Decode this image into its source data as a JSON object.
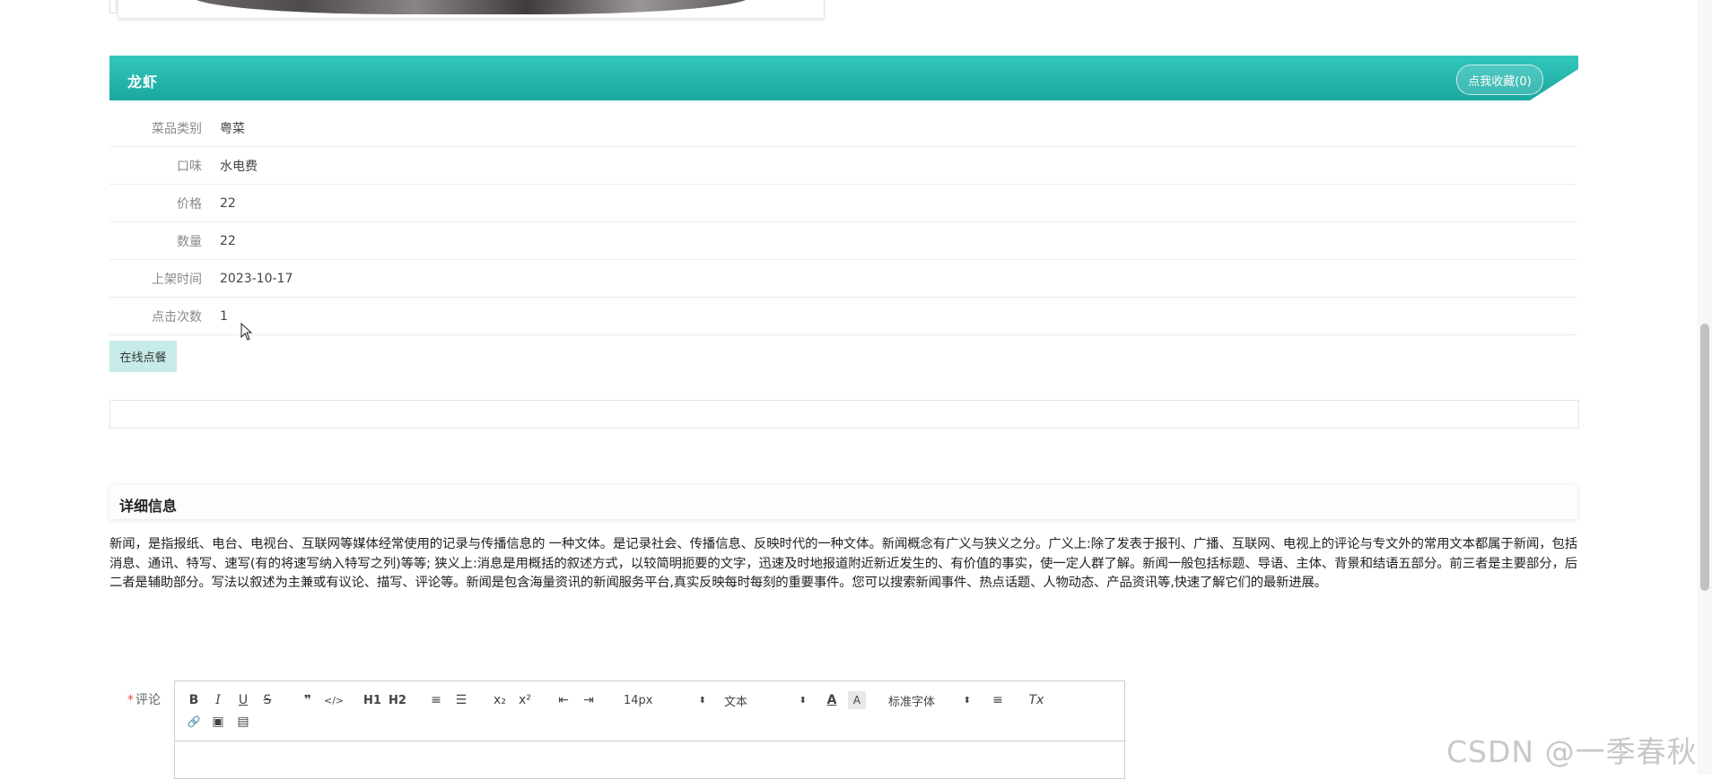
{
  "dish": {
    "title": "龙虾",
    "collect_button": "点我收藏(0)"
  },
  "info_rows": [
    {
      "label": "菜品类别",
      "value": "粤菜"
    },
    {
      "label": "口味",
      "value": "水电费"
    },
    {
      "label": "价格",
      "value": "22"
    },
    {
      "label": "数量",
      "value": "22"
    },
    {
      "label": "上架时间",
      "value": "2023-10-17"
    },
    {
      "label": "点击次数",
      "value": "1"
    }
  ],
  "order_button": "在线点餐",
  "details": {
    "section_title": "详细信息",
    "text": "新闻，是指报纸、电台、电视台、互联网等媒体经常使用的记录与传播信息的 一种文体。是记录社会、传播信息、反映时代的一种文体。新闻概念有广义与狭义之分。广义上:除了发表于报刊、广播、互联网、电视上的评论与专文外的常用文本都属于新闻，包括消息、通讯、特写、速写(有的将速写纳入特写之列)等等; 狭义上:消息是用概括的叙述方式，以较简明扼要的文字，迅速及时地报道附近新近发生的、有价值的事实，使一定人群了解。新闻一般包括标题、导语、主体、背景和结语五部分。前三者是主要部分，后二者是辅助部分。写法以叙述为主兼或有议论、描写、评论等。新闻是包含海量资讯的新闻服务平台,真实反映每时每刻的重要事件。您可以搜索新闻事件、热点话题、人物动态、产品资讯等,快速了解它们的最新进展。"
  },
  "comment": {
    "required_mark": "*",
    "label": "评论",
    "toolbar": {
      "bold": "B",
      "italic": "I",
      "underline": "U",
      "strike": "S",
      "blockquote": "❞",
      "code": "</>",
      "h1": "H1",
      "h2": "H2",
      "ordered_list": "≡",
      "bullet_list": "☰",
      "subscript": "x₂",
      "superscript": "x²",
      "outdent": "⇤",
      "indent": "⇥",
      "size": "14px",
      "header": "文本",
      "color": "A",
      "background": "A",
      "font": "标准字体",
      "align": "≡",
      "clean": "Tx",
      "link": "🔗",
      "image": "▣",
      "video": "▤"
    }
  },
  "watermark": "CSDN @一季春秋"
}
